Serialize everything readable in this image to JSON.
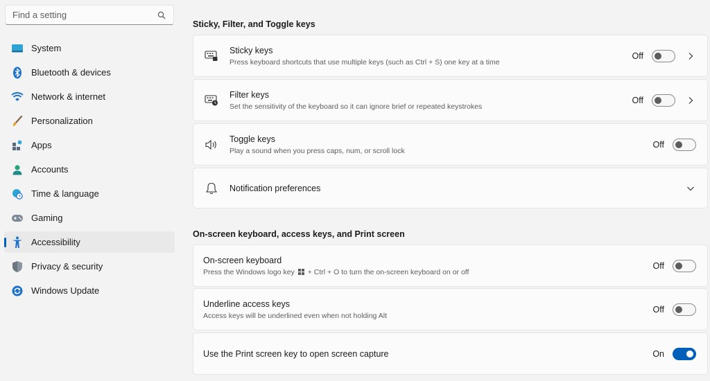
{
  "search": {
    "placeholder": "Find a setting"
  },
  "sidebar": {
    "items": [
      {
        "label": "System",
        "icon": "system-icon"
      },
      {
        "label": "Bluetooth & devices",
        "icon": "bluetooth-icon"
      },
      {
        "label": "Network & internet",
        "icon": "wifi-icon"
      },
      {
        "label": "Personalization",
        "icon": "brush-icon"
      },
      {
        "label": "Apps",
        "icon": "apps-icon"
      },
      {
        "label": "Accounts",
        "icon": "person-icon"
      },
      {
        "label": "Time & language",
        "icon": "clock-globe-icon"
      },
      {
        "label": "Gaming",
        "icon": "controller-icon"
      },
      {
        "label": "Accessibility",
        "icon": "accessibility-icon",
        "active": true
      },
      {
        "label": "Privacy & security",
        "icon": "shield-icon"
      },
      {
        "label": "Windows Update",
        "icon": "update-icon"
      }
    ]
  },
  "main": {
    "section1": {
      "title": "Sticky, Filter, and Toggle keys",
      "sticky": {
        "title": "Sticky keys",
        "desc": "Press keyboard shortcuts that use multiple keys (such as Ctrl + S) one key at a time",
        "state": "Off"
      },
      "filter": {
        "title": "Filter keys",
        "desc": "Set the sensitivity of the keyboard so it can ignore brief or repeated keystrokes",
        "state": "Off"
      },
      "toggle": {
        "title": "Toggle keys",
        "desc": "Play a sound when you press caps, num, or scroll lock",
        "state": "Off"
      },
      "notify": {
        "title": "Notification preferences"
      }
    },
    "section2": {
      "title": "On-screen keyboard, access keys, and Print screen",
      "osk": {
        "title": "On-screen keyboard",
        "desc_before": "Press the Windows logo key",
        "desc_after": "+ Ctrl + O to turn the on-screen keyboard on or off",
        "state": "Off"
      },
      "underline": {
        "title": "Underline access keys",
        "desc": "Access keys will be underlined even when not holding Alt",
        "state": "Off"
      },
      "printscreen": {
        "title": "Use the Print screen key to open screen capture",
        "state": "On"
      }
    }
  },
  "colors": {
    "accent": "#005fb8",
    "background": "#f3f3f3",
    "card": "#fbfbfb"
  }
}
